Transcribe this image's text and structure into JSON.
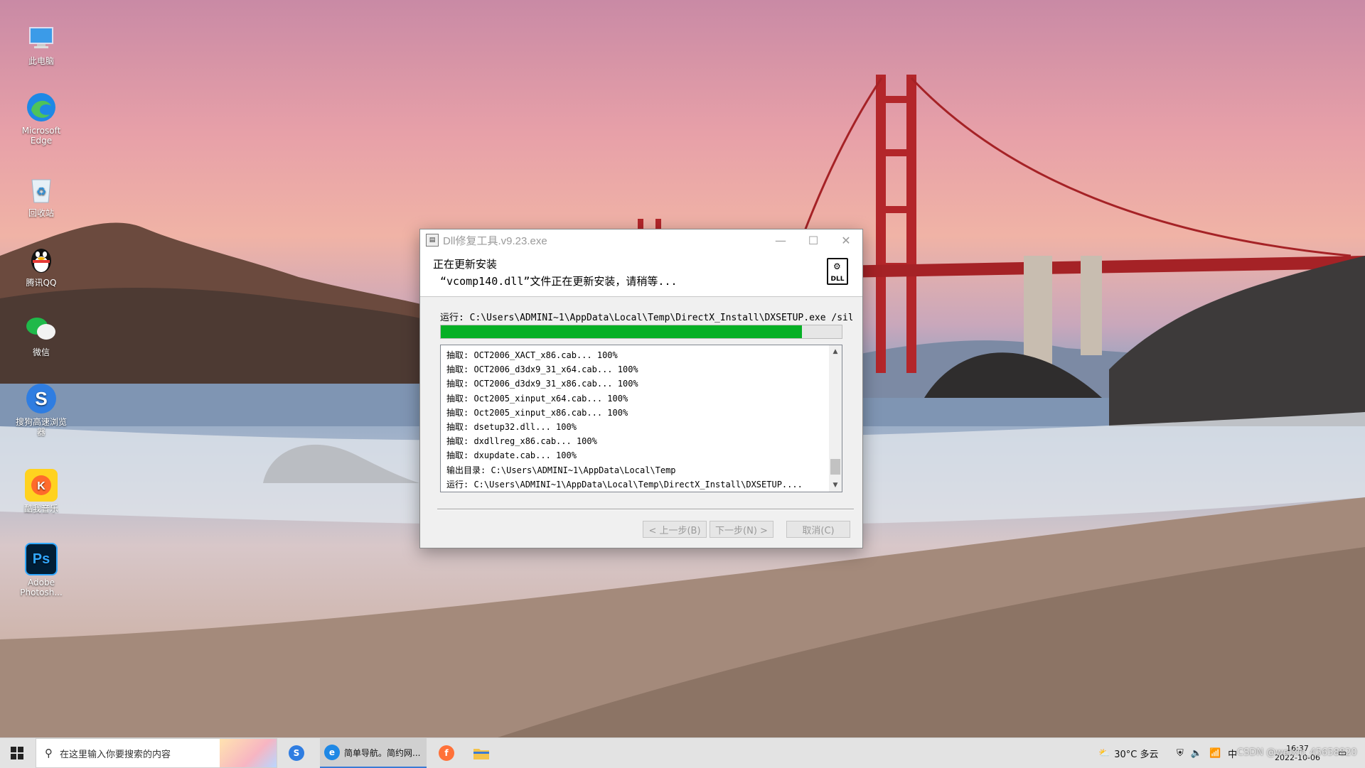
{
  "desktop": {
    "icons": [
      {
        "label": "此电脑",
        "icon": "computer-icon"
      },
      {
        "label": "Microsoft Edge",
        "icon": "edge-icon"
      },
      {
        "label": "回收站",
        "icon": "recycle-bin-icon"
      },
      {
        "label": "腾讯QQ",
        "icon": "qq-icon"
      },
      {
        "label": "微信",
        "icon": "wechat-icon"
      },
      {
        "label": "搜狗高速浏览器",
        "icon": "sogou-browser-icon"
      },
      {
        "label": "酷我音乐",
        "icon": "kuwo-music-icon"
      },
      {
        "label": "Adobe Photosh...",
        "icon": "photoshop-icon"
      }
    ]
  },
  "dialog": {
    "title": "Dll修复工具.v9.23.exe",
    "header_title": "正在更新安装",
    "header_subtitle": "“vcomp140.dll”文件正在更新安装，请稍等...",
    "run_line": "运行: C:\\Users\\ADMINI~1\\AppData\\Local\\Temp\\DirectX_Install\\DXSETUP.exe /sil",
    "progress": 0.9,
    "progress_color": "#06b025",
    "log": [
      "抽取: OCT2006_XACT_x86.cab... 100%",
      "抽取: OCT2006_d3dx9_31_x64.cab... 100%",
      "抽取: OCT2006_d3dx9_31_x86.cab... 100%",
      "抽取: Oct2005_xinput_x64.cab... 100%",
      "抽取: Oct2005_xinput_x86.cab... 100%",
      "抽取: dsetup32.dll... 100%",
      "抽取: dxdllreg_x86.cab... 100%",
      "抽取: dxupdate.cab... 100%",
      "输出目录: C:\\Users\\ADMINI~1\\AppData\\Local\\Temp",
      "运行: C:\\Users\\ADMINI~1\\AppData\\Local\\Temp\\DirectX_Install\\DXSETUP...."
    ],
    "buttons": {
      "back": "< 上一步(B)",
      "next": "下一步(N) >",
      "cancel": "取消(C)"
    },
    "header_icon_text": "DLL"
  },
  "taskbar": {
    "search_placeholder": "在这里输入你要搜索的内容",
    "edge_window_label": "简单导航。简约网...",
    "weather": "30°C 多云",
    "time": "16:37",
    "date": "2022-10-06",
    "watermark": "CSDN @weixin_45658820"
  }
}
